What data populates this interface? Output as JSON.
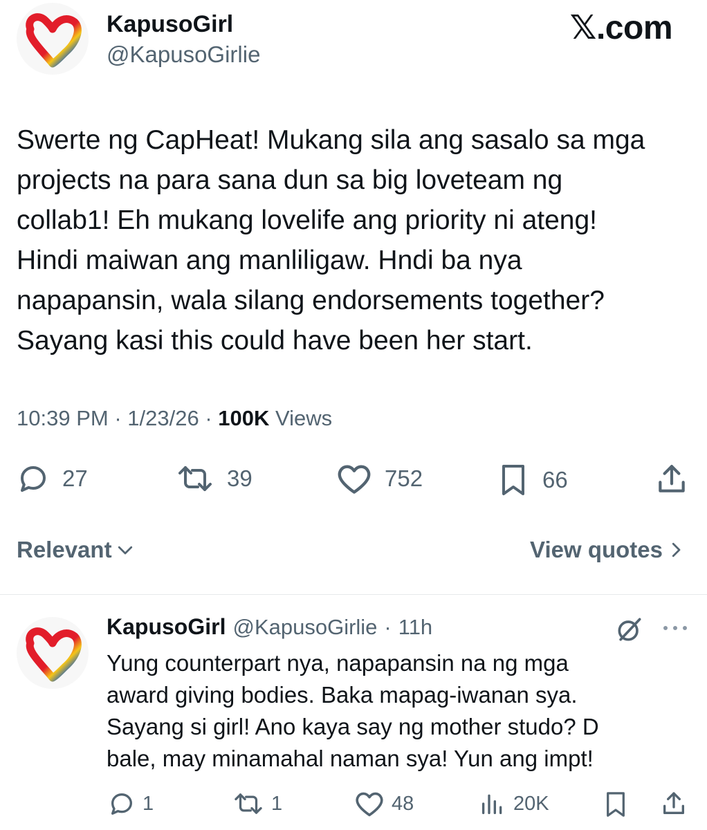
{
  "brand": "𝕏.com",
  "tweet": {
    "author_name": "KapusoGirl",
    "author_handle": "@KapusoGirlie",
    "text": "Swerte ng CapHeat! Mukang sila ang sasalo sa mga\nprojects na para sana dun sa big loveteam ng\ncollab1! Eh mukang lovelife ang priority ni ateng!\nHindi maiwan ang manliligaw. Hndi ba nya\nnapapansin, wala silang endorsements together?\nSayang kasi this could have been her start.",
    "time": "10:39 PM",
    "date": "1/23/26",
    "views_count": "100K",
    "views_label": "Views",
    "sep": "·"
  },
  "actions": {
    "replies": "27",
    "reposts": "39",
    "likes": "752",
    "bookmarks": "66"
  },
  "sort_bar": {
    "sort_label": "Relevant",
    "quotes_label": "View quotes"
  },
  "reply": {
    "author_name": "KapusoGirl",
    "author_handle": "@KapusoGirlie",
    "time": "11h",
    "sep": "·",
    "text": "Yung counterpart nya, napapansin na ng mga\naward giving bodies. Baka mapag-iwanan sya.\nSayang si girl! Ano kaya say ng mother studo? D\nbale, may minamahal naman sya! Yun ang impt!",
    "replies": "1",
    "reposts": "1",
    "likes": "48",
    "views": "20K"
  },
  "colors": {
    "text_primary": "#0f1419",
    "text_secondary": "#536471",
    "divider": "#e7e9eb",
    "logo_red": "#e21d2a",
    "logo_yellow": "#f5c518",
    "logo_blue": "#1f5fbf"
  },
  "icons": [
    "heart-logo-icon",
    "reply-icon",
    "repost-icon",
    "like-icon",
    "bookmark-icon",
    "share-icon",
    "chevron-down-icon",
    "chevron-right-icon",
    "grok-icon",
    "more-icon",
    "views-icon"
  ]
}
